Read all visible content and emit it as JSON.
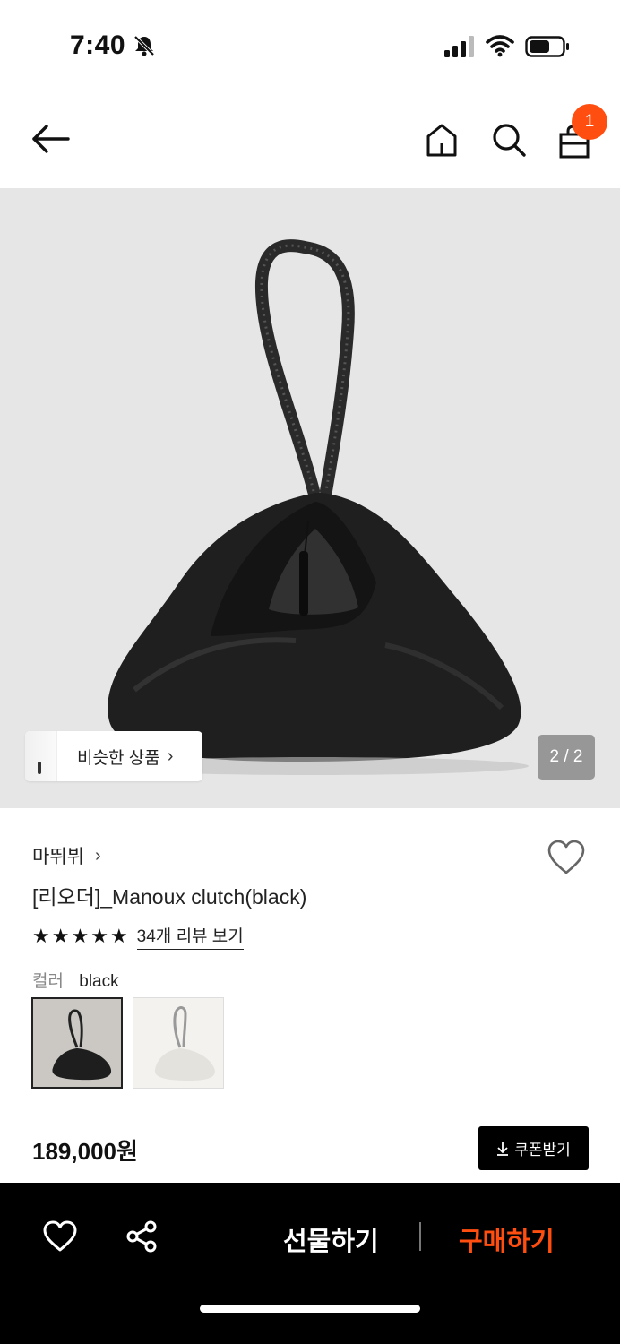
{
  "status_bar": {
    "time": "7:40"
  },
  "nav": {
    "cart_count": "1"
  },
  "gallery": {
    "similar_label": "비슷한 상품",
    "pager": "2 / 2"
  },
  "product": {
    "brand": "마뛰뷔",
    "title": "[리오더]_Manoux clutch(black)",
    "rating_stars": 5,
    "review_link": "34개 리뷰 보기",
    "color_label": "컬러",
    "color_value": "black",
    "price": "189,000원",
    "coupon_label": "쿠폰받기"
  },
  "bottom_bar": {
    "gift_label": "선물하기",
    "buy_label": "구매하기"
  },
  "colors": {
    "accent": "#ff4e0f",
    "bar_bg": "#000000",
    "hero_bg": "#e6e6e6"
  }
}
